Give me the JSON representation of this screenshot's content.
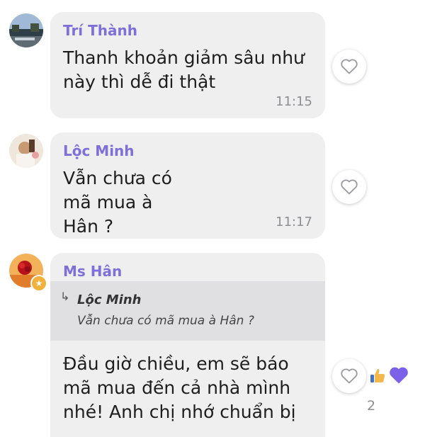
{
  "messages": [
    {
      "sender": "Trí Thành",
      "text": "Thanh khoản giảm sâu như này thì dễ đi thật",
      "time": "11:15"
    },
    {
      "sender": "Lộc Minh",
      "text": "Vẫn chưa có mã mua à Hân ?",
      "time": "11:17"
    },
    {
      "sender": "Ms Hân",
      "quote": {
        "sender": "Lộc Minh",
        "text": "Vẫn chưa có mã mua à Hân ?"
      },
      "text": "Đầu giờ chiều, em sẽ báo mã mua đến cả nhà mình nhé! Anh chị nhớ chuẩn bị",
      "reactions": {
        "icons": [
          "thumbs-up-icon",
          "heart-icon"
        ],
        "count": "2"
      }
    }
  ],
  "colors": {
    "sender_name": "#7e70d8",
    "bubble_bg": "#efeff0",
    "quote_bg": "#e0e0e3",
    "reaction_heart": "#7b61e8",
    "reaction_thumb": "#f2b84b"
  }
}
